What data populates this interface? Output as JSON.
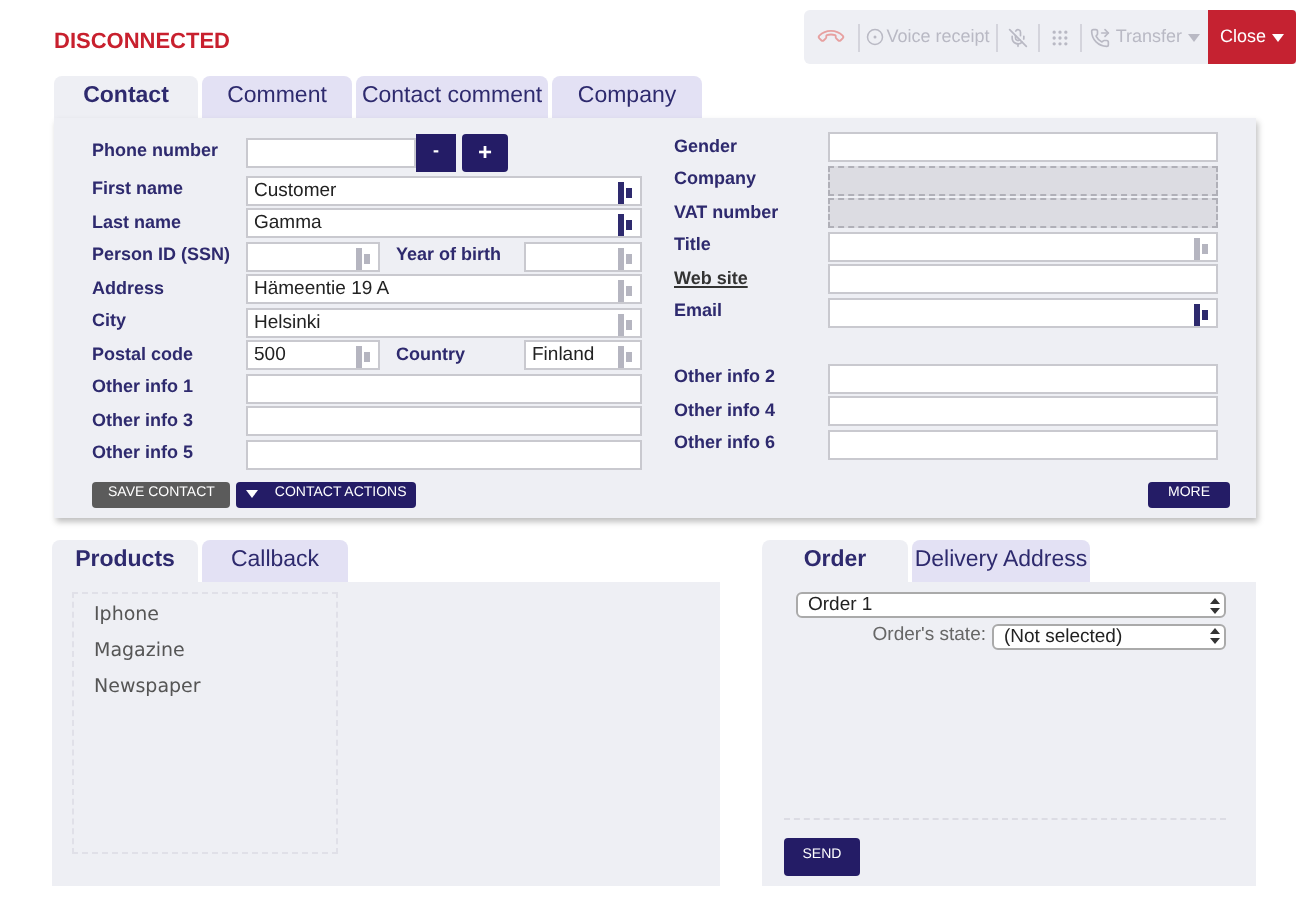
{
  "status": "DISCONNECTED",
  "toolbar": {
    "voice_receipt": "Voice receipt",
    "transfer": "Transfer",
    "close": "Close"
  },
  "contact_tabs": [
    {
      "label": "Contact",
      "selected": true
    },
    {
      "label": "Comment",
      "selected": false
    },
    {
      "label": "Contact comment",
      "selected": false
    },
    {
      "label": "Company",
      "selected": false
    }
  ],
  "left_rows": [
    {
      "kind": "phone",
      "label": "Phone number",
      "minus": "-",
      "plus": "+"
    },
    {
      "kind": "text",
      "label": "First name",
      "value": "Customer",
      "lookup": true,
      "active": true
    },
    {
      "kind": "text",
      "label": "Last name",
      "value": "Gamma",
      "lookup": true,
      "active": true
    },
    {
      "kind": "pair",
      "fields": [
        {
          "label": "Person ID (SSN)",
          "lookup": true,
          "active": false
        },
        {
          "label": "Year of birth",
          "lookup": true,
          "active": false
        }
      ]
    },
    {
      "kind": "text",
      "label": "Address",
      "value": "Hämeentie 19 A",
      "lookup": true,
      "active": false
    },
    {
      "kind": "text",
      "label": "City",
      "value": "Helsinki",
      "lookup": true,
      "active": false
    },
    {
      "kind": "pair",
      "fields": [
        {
          "label": "Postal code",
          "value": "500",
          "lookup": true,
          "active": false
        },
        {
          "label": "Country",
          "value": "Finland",
          "lookup": true,
          "active": false
        }
      ]
    },
    {
      "kind": "text",
      "label": "Other info 1"
    },
    {
      "kind": "text",
      "label": "Other info 3"
    },
    {
      "kind": "text",
      "label": "Other info 5"
    }
  ],
  "right_groups": [
    [
      {
        "label": "Gender",
        "disabled": false,
        "link": false
      },
      {
        "label": "Company",
        "disabled": true,
        "link": false
      },
      {
        "label": "VAT number",
        "disabled": true,
        "link": false
      },
      {
        "label": "Title",
        "disabled": false,
        "lookup": true,
        "active": false,
        "link": false
      },
      {
        "label": "Web site",
        "disabled": false,
        "link": true
      },
      {
        "label": "Email",
        "disabled": false,
        "lookup": true,
        "active": true,
        "link": false
      }
    ],
    [
      {
        "label": "Other info 2",
        "disabled": false,
        "link": false
      },
      {
        "label": "Other info 4",
        "disabled": false,
        "link": false
      },
      {
        "label": "Other info 6",
        "disabled": false,
        "link": false
      }
    ]
  ],
  "save_contact": "SAVE CONTACT",
  "contact_actions": "CONTACT ACTIONS",
  "more": "MORE",
  "product_tabs": [
    {
      "label": "Products",
      "selected": true
    },
    {
      "label": "Callback",
      "selected": false
    }
  ],
  "products": [
    "Iphone",
    "Magazine",
    "Newspaper"
  ],
  "order_tabs": [
    {
      "label": "Order",
      "selected": true
    },
    {
      "label": "Delivery Address",
      "selected": false
    }
  ],
  "order_select": "Order 1",
  "order_state_label": "Order's state:",
  "order_state": "(Not selected)",
  "send": "SEND"
}
